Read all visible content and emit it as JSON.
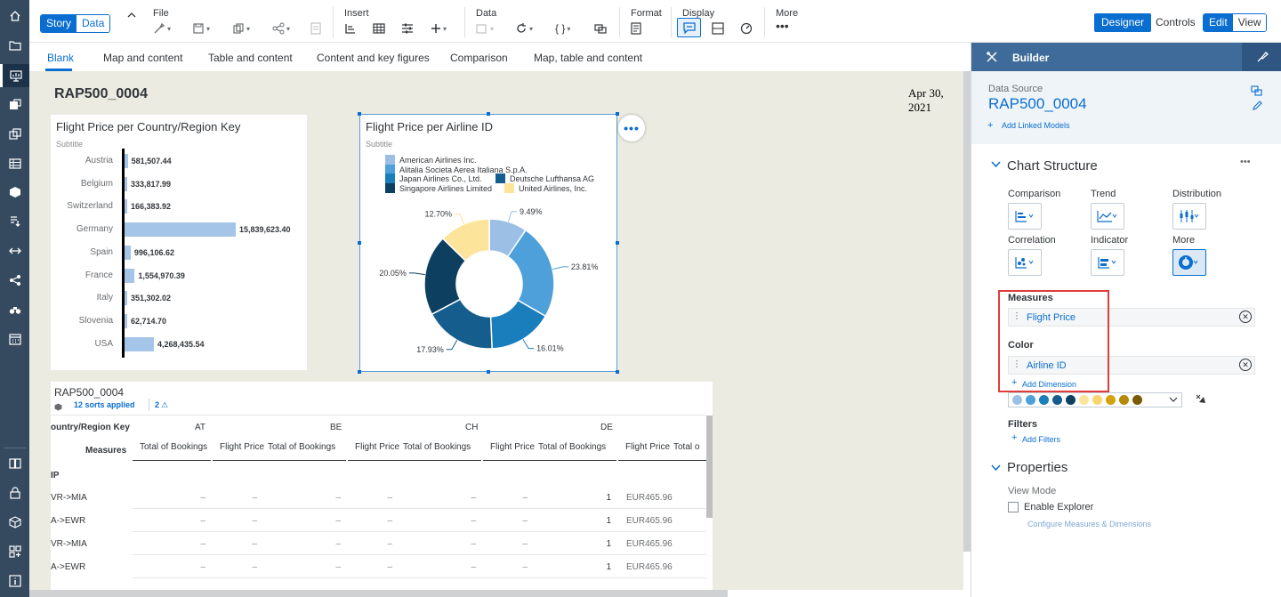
{
  "toolbar": {
    "story_label": "Story",
    "data_label": "Data",
    "file_label": "File",
    "insert_label": "Insert",
    "data_group_label": "Data",
    "format_label": "Format",
    "display_label": "Display",
    "more_label": "More",
    "designer_label": "Designer",
    "controls_label": "Controls",
    "edit_label": "Edit",
    "view_label": "View"
  },
  "tabs": [
    "Blank",
    "Map and content",
    "Table and content",
    "Content and key figures",
    "Comparison",
    "Map, table and content"
  ],
  "page": {
    "title": "RAP500_0004",
    "date": "Apr 30, 2021"
  },
  "bar_widget": {
    "title": "Flight Price per Country/Region Key",
    "subtitle": "Subtitle",
    "chart_data": {
      "type": "bar",
      "orientation": "horizontal",
      "categories": [
        "Austria",
        "Belgium",
        "Switzerland",
        "Germany",
        "Spain",
        "France",
        "Italy",
        "Slovenia",
        "USA"
      ],
      "values": [
        581507.44,
        333817.99,
        166383.92,
        15839623.4,
        996106.62,
        1554970.39,
        351302.02,
        62714.7,
        4268435.54
      ],
      "labels": [
        "581,507.44",
        "333,817.99",
        "166,383.92",
        "15,839,623.40",
        "996,106.62",
        "1,554,970.39",
        "351,302.02",
        "62,714.70",
        "4,268,435.54"
      ],
      "color": "#a5c5e8"
    }
  },
  "donut_widget": {
    "title": "Flight Price per Airline ID",
    "subtitle": "Subtitle",
    "chart_data": {
      "type": "pie",
      "donut": true,
      "legend": [
        {
          "name": "American Airlines Inc.",
          "color": "#9cc0e5"
        },
        {
          "name": "Alitalia Societa Aerea Italiana S.p.A.",
          "color": "#4ea0da"
        },
        {
          "name": "Japan Airlines Co., Ltd.",
          "color": "#1a7dbc"
        },
        {
          "name": "Deutsche Lufthansa AG",
          "color": "#145d8c"
        },
        {
          "name": "Singapore Airlines Limited",
          "color": "#0d4060"
        },
        {
          "name": "United Airlines, Inc.",
          "color": "#fde49b"
        }
      ],
      "slices": [
        {
          "value": 9.49,
          "label": "9.49%",
          "color": "#9cc0e5"
        },
        {
          "value": 23.81,
          "label": "23.81%",
          "color": "#4ea0da"
        },
        {
          "value": 16.01,
          "label": "16.01%",
          "color": "#1a7dbc"
        },
        {
          "value": 17.93,
          "label": "17.93%",
          "color": "#145d8c"
        },
        {
          "value": 20.05,
          "label": "20.05%",
          "color": "#0d4060"
        },
        {
          "value": 12.7,
          "label": "12.70%",
          "color": "#fde49b"
        }
      ]
    }
  },
  "table_widget": {
    "title": "RAP500_0004",
    "sorts": "12 sorts applied",
    "warnings": "2",
    "row_header": "ountry/Region Key",
    "measures_label": "Measures",
    "group_label": "IP",
    "countries": [
      "AT",
      "BE",
      "CH",
      "DE"
    ],
    "col_headers": [
      "Total of Bookings",
      "Flight Price",
      "Total of Bookings",
      "Flight Price",
      "Total of Bookings",
      "Flight Price",
      "Total of Bookings",
      "Flight Price",
      "Total o"
    ],
    "rows": [
      {
        "label": "VR->MIA",
        "cells": [
          "–",
          "–",
          "–",
          "–",
          "–",
          "–",
          "1",
          "EUR465.96"
        ]
      },
      {
        "label": "A->EWR",
        "cells": [
          "–",
          "–",
          "–",
          "–",
          "–",
          "–",
          "1",
          "EUR465.96"
        ]
      },
      {
        "label": "VR->MIA",
        "cells": [
          "–",
          "–",
          "–",
          "–",
          "–",
          "–",
          "1",
          "EUR465.96"
        ]
      },
      {
        "label": "A->EWR",
        "cells": [
          "–",
          "–",
          "–",
          "–",
          "–",
          "–",
          "1",
          "EUR465.96"
        ]
      }
    ]
  },
  "builder": {
    "title": "Builder",
    "data_source_label": "Data Source",
    "data_source_name": "RAP500_0004",
    "add_linked_models": "Add Linked Models",
    "chart_structure": "Chart Structure",
    "chart_types": [
      "Comparison",
      "Trend",
      "Distribution",
      "Correlation",
      "Indicator",
      "More"
    ],
    "measures_label": "Measures",
    "measure_value": "Flight Price",
    "color_label": "Color",
    "color_value": "Airline ID",
    "add_dimension": "Add Dimension",
    "palette": [
      "#9cc0e5",
      "#4ea0da",
      "#1a7dbc",
      "#145d8c",
      "#0d4060",
      "#fde49b",
      "#f8d66d",
      "#d4a20d",
      "#b58a08",
      "#7a5b04"
    ],
    "filters_label": "Filters",
    "add_filters": "Add Filters",
    "properties_label": "Properties",
    "view_mode_label": "View Mode",
    "enable_explorer": "Enable Explorer",
    "configure_link": "Configure Measures & Dimensions"
  }
}
